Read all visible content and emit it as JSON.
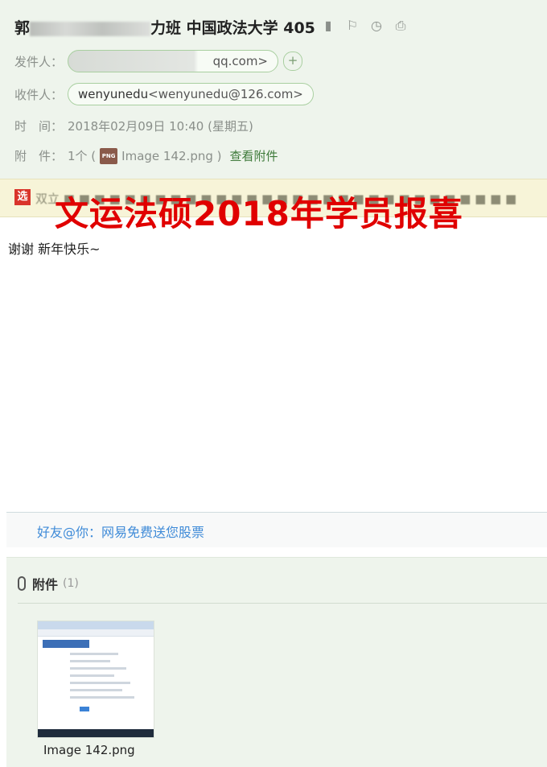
{
  "header": {
    "subject_prefix": "郭",
    "subject_suffix": "力班 中国政法大学 405",
    "tools": [
      {
        "icon": "bookmark-icon",
        "glyph": "▮"
      },
      {
        "icon": "flag-icon",
        "glyph": "⚐"
      },
      {
        "icon": "clock-icon",
        "glyph": "◷"
      },
      {
        "icon": "print-icon",
        "glyph": "⎙"
      }
    ],
    "from_label": "发件人：",
    "from_value": "qq.com>",
    "from_add": "+",
    "to_label": "收件人：",
    "to_name": "wenyunedu",
    "to_email": "<wenyunedu@126.com>",
    "time_label": "时　间：",
    "time_value": "2018年02月09日 10:40 (星期五)",
    "attach_label": "附　件：",
    "attach_count": "1个 (",
    "attach_icon": "PNG",
    "attach_file": "Image 142.png )",
    "attach_view": "查看附件"
  },
  "banner": {
    "icon": "选",
    "text": "双立 ■ ■ ■ ■ ■ ■ ■ ■ ■ ■ ■ ■ ■ ■ ■ ■ ■ ■ ■ ■ ■ ■ ■ ■ ■ ■ ■ ■ ■ ■"
  },
  "watermark": "文运法硕2018年学员报喜",
  "body": {
    "text": "谢谢 新年快乐~"
  },
  "promo": "好友@你：网易免费送您股票",
  "attachments": {
    "title": "附件",
    "count": "(1)",
    "files": [
      {
        "name": "Image 142.png"
      }
    ]
  },
  "colors": {
    "header_bg": "#eef4ec",
    "accent_green": "#3e7a3a",
    "watermark_red": "#e00000",
    "link_blue": "#3f8bd8"
  }
}
